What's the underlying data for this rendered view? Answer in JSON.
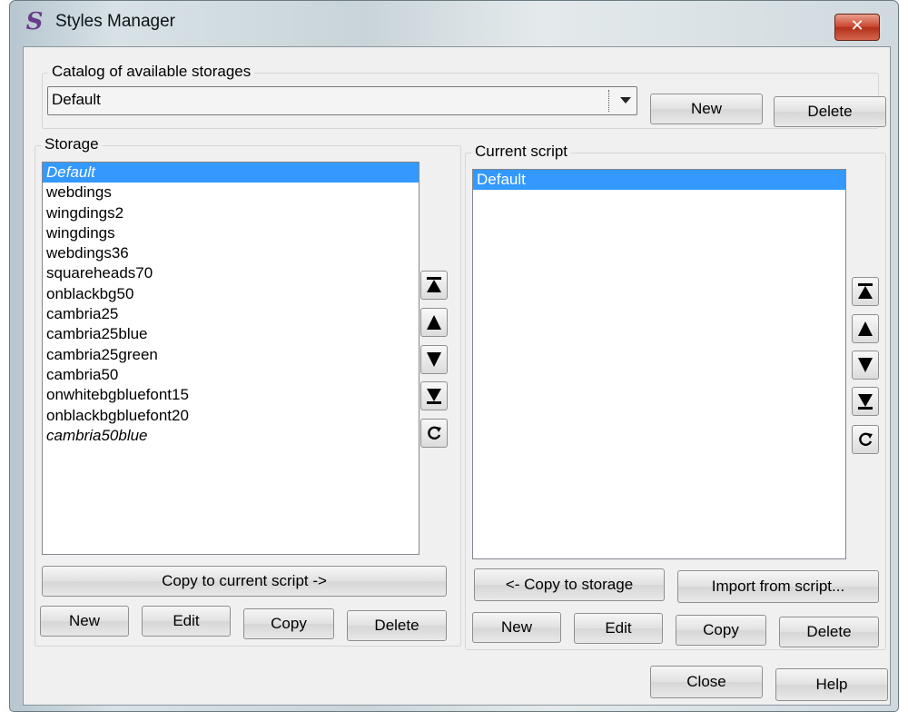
{
  "window": {
    "title": "Styles Manager",
    "close_glyph": "✕"
  },
  "catalog": {
    "label": "Catalog of available storages",
    "selected": "Default",
    "new_label": "New",
    "delete_label": "Delete"
  },
  "storage": {
    "label": "Storage",
    "items": [
      {
        "label": "Default",
        "selected": true,
        "italic": true
      },
      {
        "label": "webdings"
      },
      {
        "label": "wingdings2"
      },
      {
        "label": "wingdings"
      },
      {
        "label": "webdings36"
      },
      {
        "label": "squareheads70"
      },
      {
        "label": "onblackbg50"
      },
      {
        "label": "cambria25"
      },
      {
        "label": "cambria25blue"
      },
      {
        "label": "cambria25green"
      },
      {
        "label": "cambria50"
      },
      {
        "label": "onwhitebgbluefont15"
      },
      {
        "label": "onblackbgbluefont20"
      },
      {
        "label": "cambria50blue",
        "italic": true
      }
    ],
    "copy_label": "Copy to current script ->",
    "new_label": "New",
    "edit_label": "Edit",
    "copy_btn_label": "Copy",
    "delete_label": "Delete"
  },
  "script": {
    "label": "Current script",
    "items": [
      {
        "label": "Default",
        "selected": true
      }
    ],
    "copy_label": "<- Copy to storage",
    "import_label": "Import from script...",
    "new_label": "New",
    "edit_label": "Edit",
    "copy_btn_label": "Copy",
    "delete_label": "Delete"
  },
  "footer": {
    "close_label": "Close",
    "help_label": "Help"
  },
  "icons": [
    "move-top-icon",
    "move-up-icon",
    "move-down-icon",
    "move-bottom-icon",
    "refresh-icon"
  ],
  "colors": {
    "selection": "#3399ff",
    "close_button": "#c8432b"
  }
}
